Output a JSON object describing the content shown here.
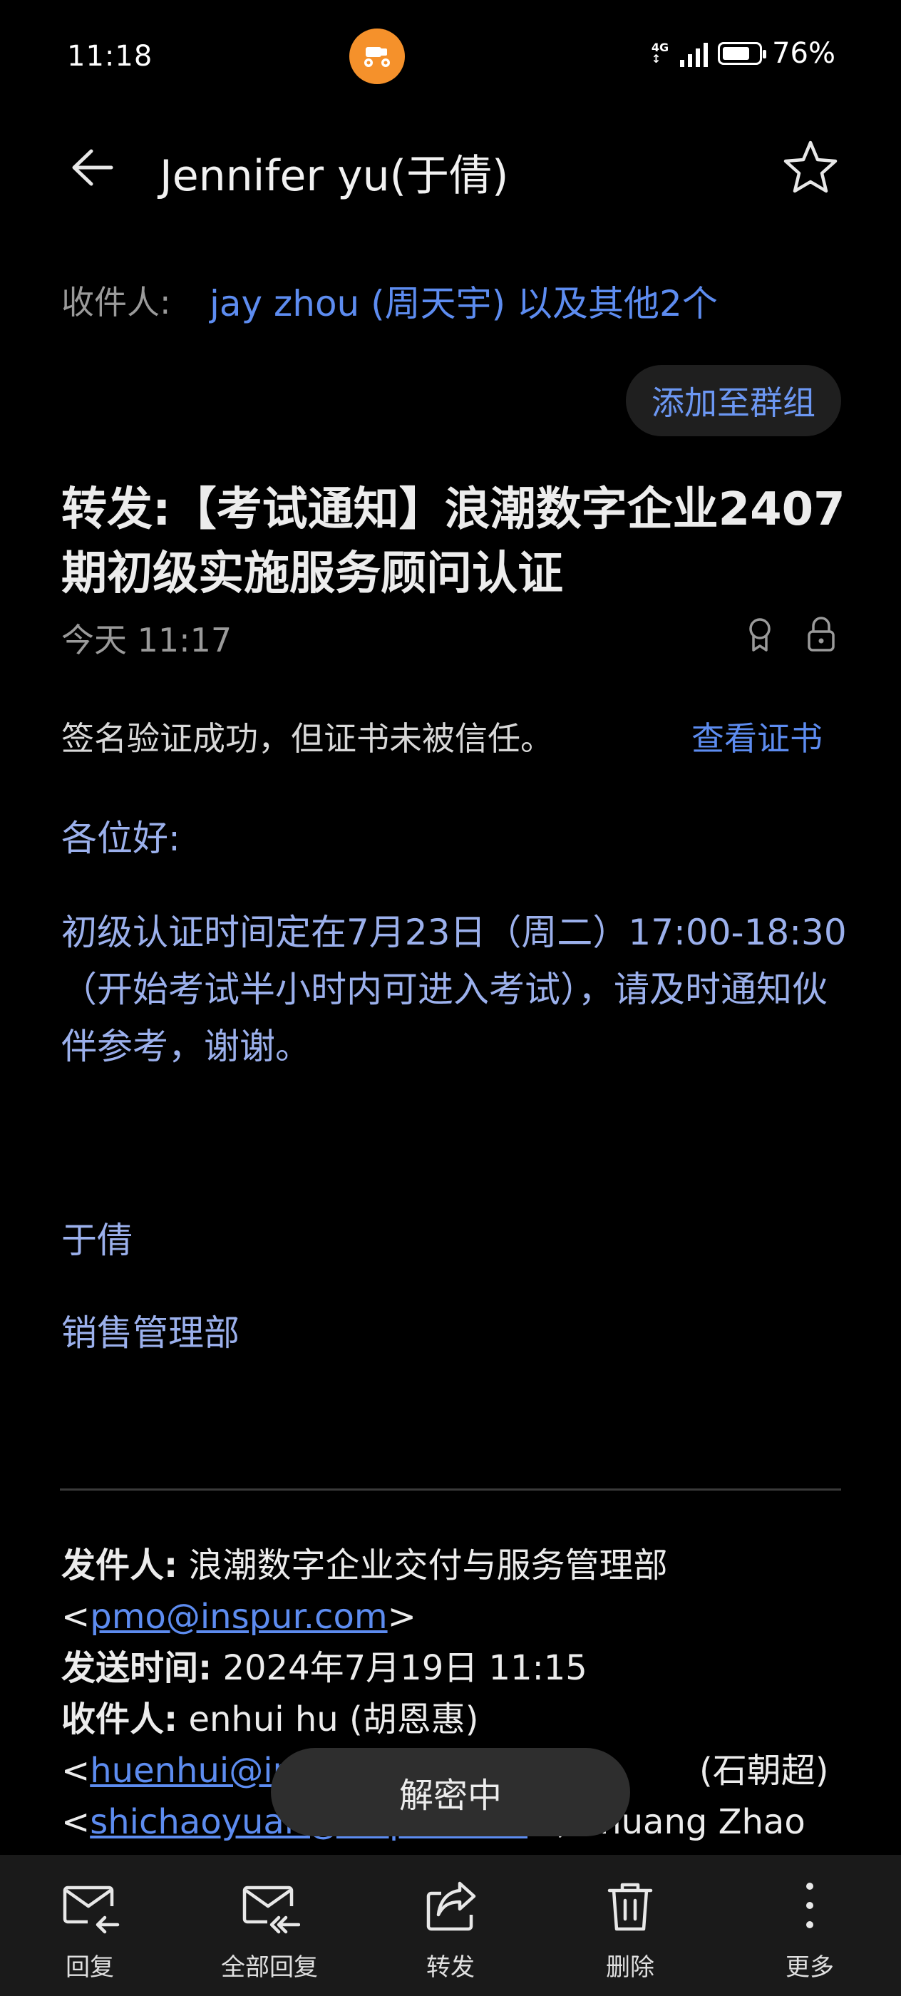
{
  "status_bar": {
    "time": "11:18",
    "network": "4G",
    "battery_percent": "76%",
    "battery_level": 0.76
  },
  "header": {
    "title": "Jennifer yu(于倩)"
  },
  "recipients": {
    "label": "收件人:",
    "value": "jay zhou (周天宇) 以及其他2个"
  },
  "add_group_label": "添加至群组",
  "subject": "转发:【考试通知】浪潮数字企业2407期初级实施服务顾问认证",
  "date": "今天 11:17",
  "signature": {
    "message": "签名验证成功，但证书未被信任。",
    "link": "查看证书"
  },
  "body": {
    "greeting": "各位好:",
    "paragraph": "初级认证时间定在7月23日（周二）17:00-18:30（开始考试半小时内可进入考试），请及时通知伙伴参考，谢谢。",
    "sign_name": "于倩",
    "sign_dept": "销售管理部"
  },
  "forwarded": {
    "from_label": "发件人:",
    "from_value": "浪潮数字企业交付与服务管理部",
    "from_email": "pmo@inspur.com",
    "sent_label": "发送时间:",
    "sent_value": "2024年7月19日 11:15",
    "to_label": "收件人:",
    "to_value": "enhui hu (胡恩惠)",
    "to_email_1": "huenhui@in",
    "to_name_2_fragment": "(石朝超)",
    "to_email_2": "shichaoyuan@inspur.com",
    "to_name_3_fragment": "Shuang Zhao"
  },
  "toast": "解密中",
  "bottom_nav": [
    {
      "label": "回复",
      "icon": "reply-icon"
    },
    {
      "label": "全部回复",
      "icon": "reply-all-icon"
    },
    {
      "label": "转发",
      "icon": "forward-icon"
    },
    {
      "label": "删除",
      "icon": "trash-icon"
    },
    {
      "label": "更多",
      "icon": "more-icon"
    }
  ],
  "colors": {
    "background": "#000000",
    "accent": "#5d8cf0",
    "app_icon": "#f5912b"
  }
}
